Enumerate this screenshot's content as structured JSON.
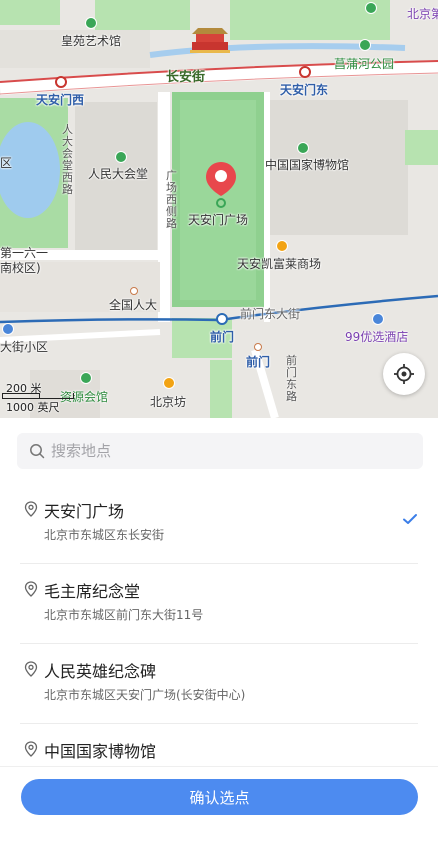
{
  "map": {
    "labels": {
      "huangyuan": "皇苑艺术馆",
      "beijing_tr": "北京第",
      "changpu": "菖蒲河公园",
      "changanjie": "长安街",
      "tam_west": "天安门西",
      "tam_east": "天安门东",
      "qu": "区",
      "renda_hall": "人民大会堂",
      "museum": "中国国家博物馆",
      "tam_square": "天安门广场",
      "kerry": "天安凯富莱商场",
      "no161": "第一六一",
      "south_campus": "南校区)",
      "npc": "全国人大",
      "qianmen_st": "前门东大街",
      "qianmen": "前门",
      "qianmen2": "前门",
      "youxuan": "99优选酒店",
      "dajie": "大街小区",
      "huiguan": "会馆",
      "beijingfang": "北京坊",
      "ziyuan": "资源会馆",
      "renda_west_road": "人大会堂西路",
      "square_west_road": "广场西侧路",
      "qianmen_east_road": "前门东路"
    },
    "scale_metric": "200 米",
    "scale_imperial": "1000 英尺"
  },
  "search": {
    "placeholder": "搜索地点",
    "value": ""
  },
  "places": [
    {
      "name": "天安门广场",
      "address": "北京市东城区东长安街",
      "selected": true
    },
    {
      "name": "毛主席纪念堂",
      "address": "北京市东城区前门东大街11号",
      "selected": false
    },
    {
      "name": "人民英雄纪念碑",
      "address": "北京市东城区天安门广场(长安街中心)",
      "selected": false
    },
    {
      "name": "中国国家博物馆",
      "address": "",
      "selected": false
    }
  ],
  "confirm_label": "确认选点",
  "colors": {
    "accent": "#4d8bf0",
    "check": "#3b7ee8",
    "pin": "#e8474c",
    "park_green": "#8fd08f"
  },
  "icons": {
    "search": "search-icon",
    "pin": "location-pin-icon",
    "locate": "locate-icon",
    "check": "check-icon"
  }
}
